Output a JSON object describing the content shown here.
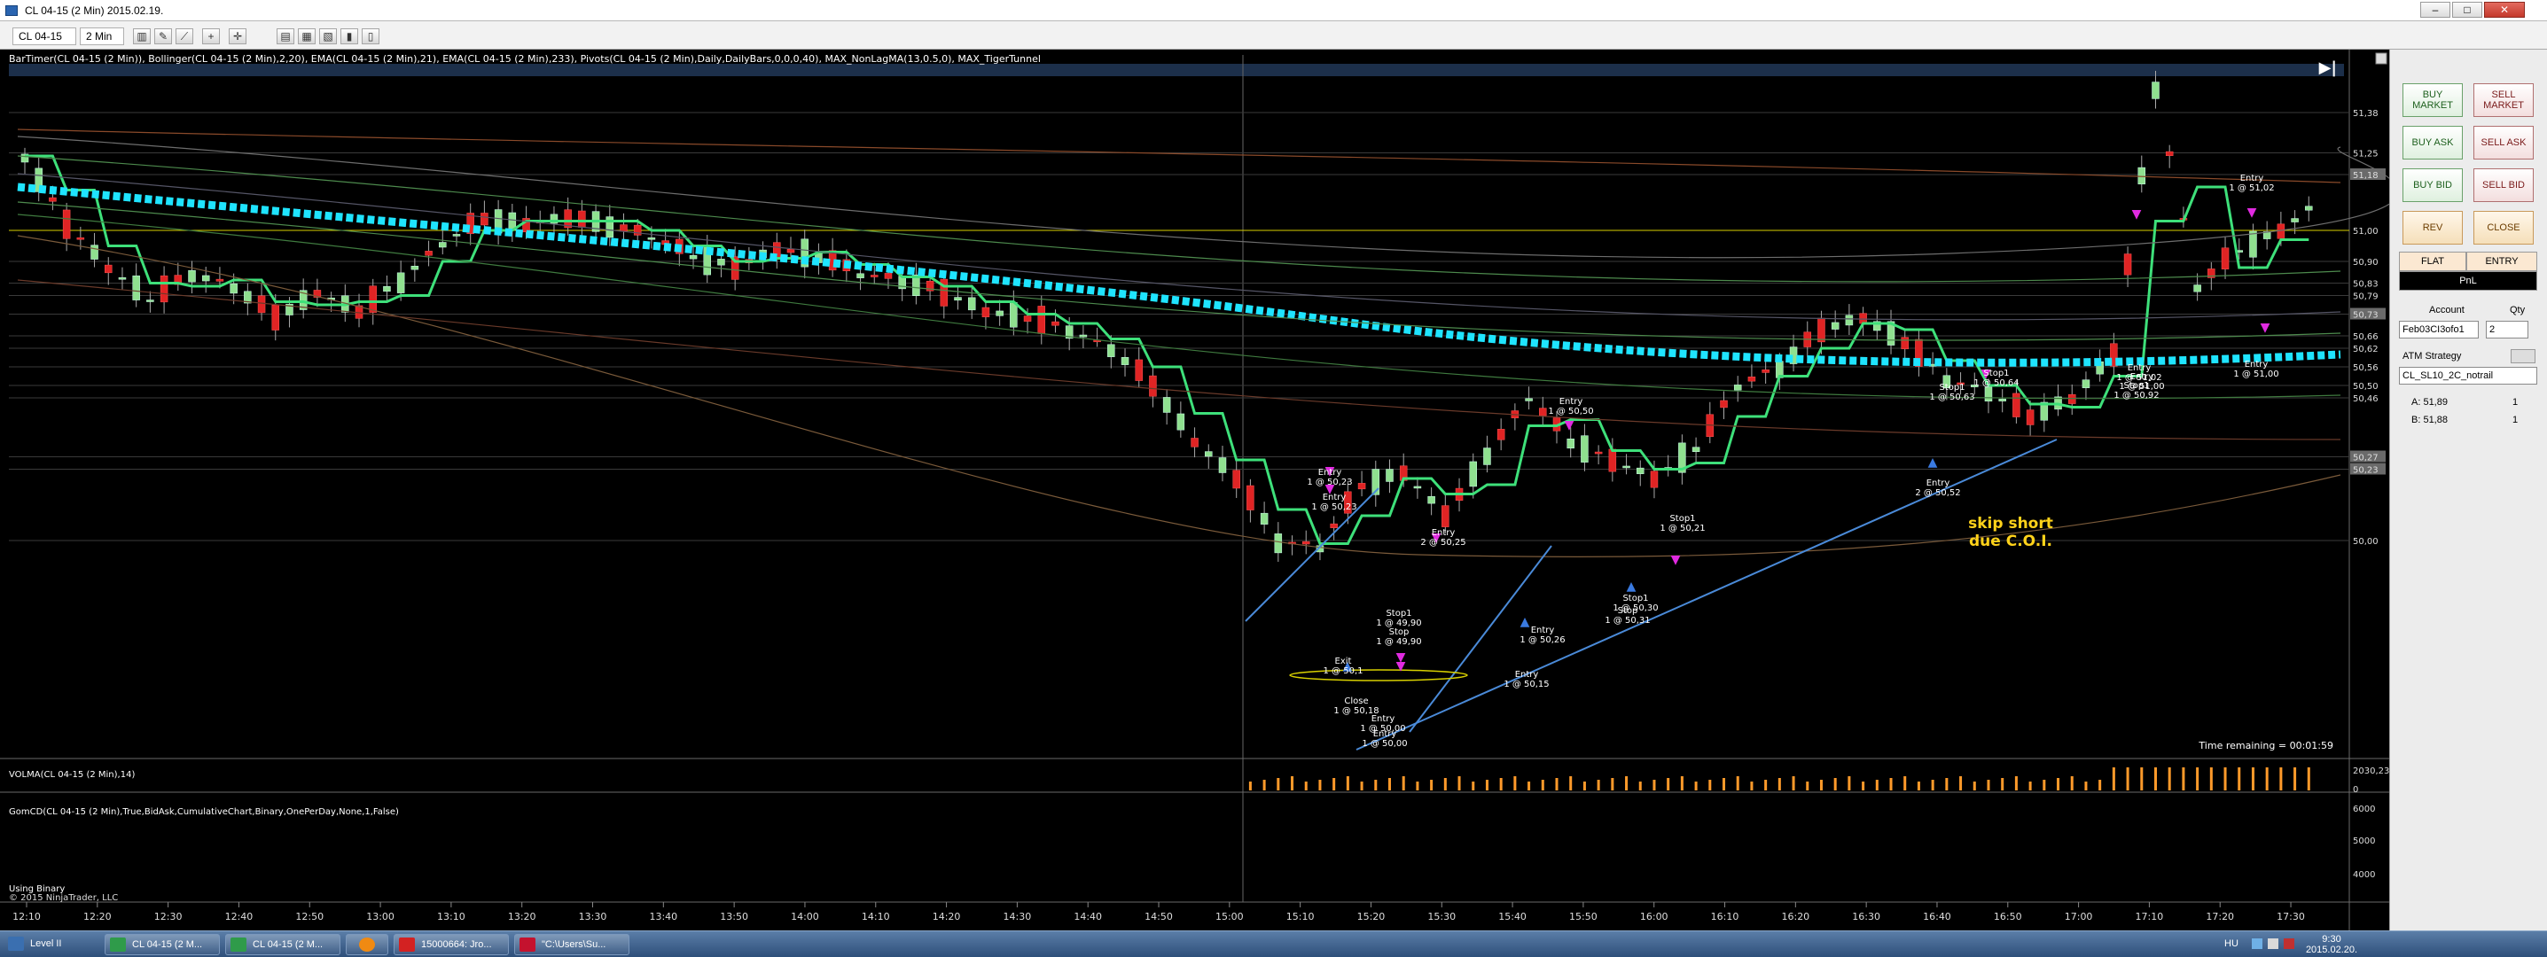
{
  "window": {
    "title": "CL 04-15 (2 Min)  2015.02.19.",
    "buttons": [
      "–",
      "□",
      "✕"
    ]
  },
  "toolbar": {
    "instrument": "CL 04-15",
    "interval": "2 Min"
  },
  "chart": {
    "indicators_line": "BarTimer(CL 04-15 (2 Min)), Bollinger(CL 04-15 (2 Min),2,20), EMA(CL 04-15 (2 Min),21), EMA(CL 04-15 (2 Min),233), Pivots(CL 04-15 (2 Min),Daily,DailyBars,0,0,0,40), MAX_NonLagMA(13,0.5,0), MAX_TigerTunnel",
    "panel2_label": "VOLMA(CL 04-15 (2 Min),14)",
    "panel3_label": "GomCD(CL 04-15 (2 Min),True,BidAsk,CumulativeChart,Binary,OnePerDay,None,1,False)",
    "using_text": "Using Binary",
    "copyright": "© 2015 NinjaTrader, LLC",
    "time_remaining": "Time remaining = 00:01:59",
    "annotation": "skip short\ndue C.O.I.",
    "price_labels": [
      "51,38",
      "51,25",
      "51,18",
      "51,00",
      "50,90",
      "50,83",
      "50,79",
      "50,73",
      "50,66",
      "50,62",
      "50,56",
      "50,50",
      "50,46",
      "50,27",
      "50,23",
      "50,00"
    ],
    "volume_labels": [
      "2030,23",
      "0"
    ],
    "gomcd_labels": [
      "6000",
      "5000",
      "4000"
    ],
    "time_labels": [
      "12:10",
      "12:20",
      "12:30",
      "12:40",
      "12:50",
      "13:00",
      "13:10",
      "13:20",
      "13:30",
      "13:40",
      "13:50",
      "14:00",
      "14:10",
      "14:20",
      "14:30",
      "14:40",
      "14:50",
      "15:00",
      "15:10",
      "15:20",
      "15:30",
      "15:40",
      "15:50",
      "16:00",
      "16:10",
      "16:20",
      "16:30",
      "16:40",
      "16:50",
      "17:00",
      "17:10",
      "17:20",
      "17:30"
    ],
    "trade_labels": [
      "Entry\n1 @ 50,23",
      "Entry\n1 @ 50,23",
      "Exit\n1 @ 50,1",
      "Close\n1 @ 50,18",
      "Stop1\n1 @ 49,90",
      "Stop\n1 @ 49,90",
      "Entry\n1 @ 50,00",
      "Entry\n1 @ 50,00",
      "Entry\n2 @ 50,25",
      "Entry\n1 @ 50,26",
      "Entry\n1 @ 50,15",
      "Entry\n1 @ 50,50",
      "Stop1\n1 @ 50,30",
      "Stop\n1 @ 50,31",
      "Stop1\n1 @ 50,21",
      "Stop1\n1 @ 50,63",
      "Stop1\n1 @ 50,64",
      "Entry\n2 @ 50,52",
      "Entry\n1 @ 51,02",
      "Entry\n1 @ 51,00",
      "Stop1\n1 @ 50,92",
      "Entry\n1 @ 51,02",
      "Entry\n1 @ 51,00"
    ]
  },
  "panel": {
    "buttons": {
      "buy_market": "BUY\nMARKET",
      "sell_market": "SELL\nMARKET",
      "buy_ask": "BUY ASK",
      "sell_ask": "SELL ASK",
      "buy_bid": "BUY BID",
      "sell_bid": "SELL BID",
      "rev": "REV",
      "close": "CLOSE",
      "flat": "FLAT",
      "entry": "ENTRY",
      "pnl": "PnL"
    },
    "account_label": "Account",
    "qty_label": "Qty",
    "account_value": "Feb03CI3ofo1",
    "qty_value": "2",
    "atm_label": "ATM Strategy",
    "atm_value": "CL_SL10_2C_notrail",
    "ask_label": "A: 51,89",
    "ask_qty": "1",
    "bid_label": "B: 51,88",
    "bid_qty": "1"
  },
  "taskbar": {
    "items": [
      "Level II",
      "CL 04-15 (2 M...",
      "CL 04-15 (2 M...",
      "",
      "15000664: Jro...",
      "\"C:\\Users\\Su..."
    ],
    "lang": "HU",
    "time": "9:30",
    "date": "2015.02.20."
  }
}
